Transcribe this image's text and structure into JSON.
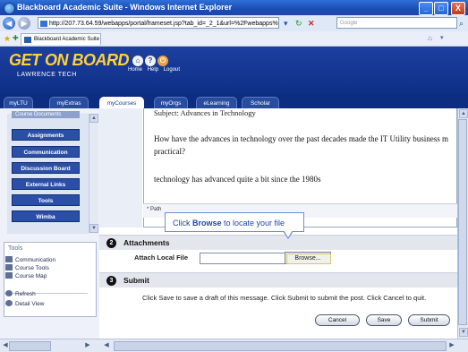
{
  "window": {
    "title": "Blackboard Academic Suite - Windows Internet Explorer",
    "minimize": "_",
    "maximize": "□",
    "close": "X"
  },
  "addressbar": {
    "url": "http://207.73.64.59/webapps/portal/frameset.jsp?tab_id=_2_1&url=%2Fwebapps%",
    "search_placeholder": "Google"
  },
  "browser_tab": {
    "label": "Blackboard Academic Suite"
  },
  "header": {
    "logo_line1": "GET ON BOARD",
    "logo_line2": "LAWRENCE TECH",
    "links": [
      "Home",
      "Help",
      "Logout"
    ]
  },
  "course_tabs": [
    {
      "label": "myLTU",
      "active": false
    },
    {
      "label": "myExtras",
      "active": false
    },
    {
      "label": "myCourses",
      "active": true
    },
    {
      "label": "myOrgs",
      "active": false
    },
    {
      "label": "eLearning",
      "active": false
    },
    {
      "label": "Scholar",
      "active": false
    }
  ],
  "sidebar": {
    "menu_head": "Course Documents",
    "menu": [
      "Assignments",
      "Communication",
      "Discussion Board",
      "External Links",
      "Tools",
      "Wimba"
    ],
    "tools_head": "Tools",
    "tools": [
      "Communication",
      "Course Tools",
      "Course Map"
    ],
    "tools2": [
      "Refresh",
      "Detail View"
    ]
  },
  "post": {
    "subject": "Subject: Advances in Technology",
    "question": "How have the advances in technology over the past decades made the IT Utility business m practical?",
    "answer": "technology has advanced quite a bit since the 1980s",
    "path": "* Path"
  },
  "callout": {
    "prefix": "Click ",
    "bold": "Browse",
    "suffix": " to locate your file"
  },
  "attachments": {
    "number": "2",
    "title": "Attachments",
    "label": "Attach Local File",
    "browse": "Browse..."
  },
  "submit": {
    "number": "3",
    "title": "Submit",
    "text": "Click Save to save a draft of this message. Click Submit to submit the post. Click Cancel to quit.",
    "buttons": [
      "Cancel",
      "Save",
      "Submit"
    ]
  }
}
